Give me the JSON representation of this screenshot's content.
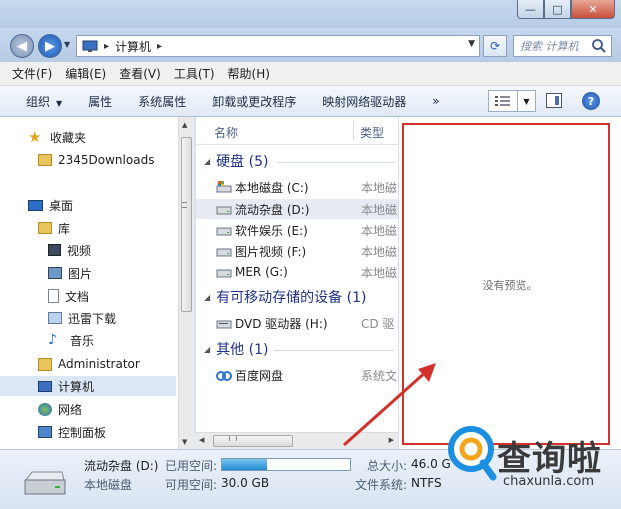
{
  "window": {
    "controls": {
      "minimize": "—",
      "maximize": "□",
      "close": "✕"
    }
  },
  "address": {
    "path": "计算机",
    "search_placeholder": "搜索 计算机"
  },
  "menu": [
    "文件(F)",
    "编辑(E)",
    "查看(V)",
    "工具(T)",
    "帮助(H)"
  ],
  "toolbar": {
    "organize": "组织",
    "properties": "属性",
    "system_properties": "系统属性",
    "uninstall": "卸载或更改程序",
    "map_drive": "映射网络驱动器",
    "more": "»"
  },
  "nav": {
    "favorites": "收藏夹",
    "downloads": "2345Downloads",
    "desktop": "桌面",
    "libraries": "库",
    "videos": "视频",
    "pictures": "图片",
    "documents": "文档",
    "thunder": "迅雷下载",
    "music": "音乐",
    "admin": "Administrator",
    "computer": "计算机",
    "network": "网络",
    "control_panel": "控制面板"
  },
  "columns": {
    "name": "名称",
    "type": "类型"
  },
  "groups": {
    "hdd": "硬盘 (5)",
    "removable": "有可移动存储的设备 (1)",
    "other": "其他 (1)"
  },
  "rows": [
    {
      "name": "本地磁盘 (C:)",
      "type": "本地磁"
    },
    {
      "name": "流动杂盘 (D:)",
      "type": "本地磁"
    },
    {
      "name": "软件娱乐 (E:)",
      "type": "本地磁"
    },
    {
      "name": "图片视频 (F:)",
      "type": "本地磁"
    },
    {
      "name": "MER (G:)",
      "type": "本地磁"
    },
    {
      "name": "DVD 驱动器 (H:)",
      "type": "CD 驱"
    },
    {
      "name": "百度网盘",
      "type": "系统文"
    }
  ],
  "preview": {
    "text": "没有预览。"
  },
  "details": {
    "name": "流动杂盘 (D:)",
    "type": "本地磁盘",
    "used_label": "已用空间:",
    "used_fraction": 0.35,
    "free_label": "可用空间:",
    "free_value": "30.0 GB",
    "total_label": "总大小:",
    "total_value": "46.0 G",
    "fs_label": "文件系统:",
    "fs_value": "NTFS"
  },
  "watermark": {
    "brand": "查询啦",
    "url": "chaxunla.com"
  },
  "colors": {
    "highlight": "#d2322b",
    "accent": "#1e3287"
  }
}
